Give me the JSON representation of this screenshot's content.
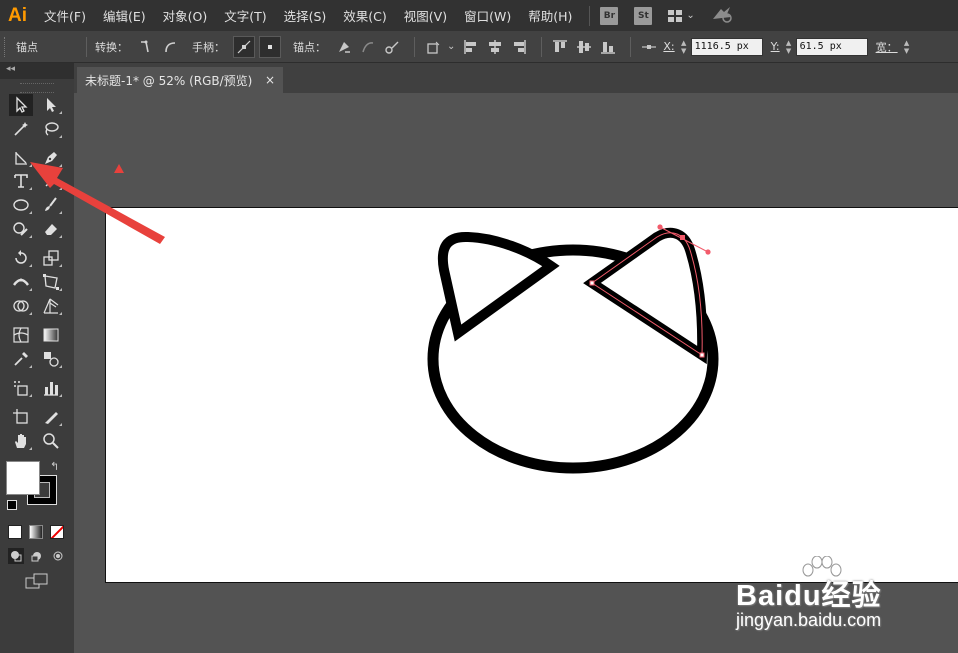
{
  "app": {
    "logo": "Ai",
    "logo_color": "#ff9a00"
  },
  "menu": {
    "items": [
      "文件(F)",
      "编辑(E)",
      "对象(O)",
      "文字(T)",
      "选择(S)",
      "效果(C)",
      "视图(V)",
      "窗口(W)",
      "帮助(H)"
    ],
    "bridge_label": "Br",
    "stock_label": "St"
  },
  "control_bar": {
    "title": "锚点",
    "convert_label": "转换：",
    "handles_label": "手柄：",
    "anchors_label": "锚点：",
    "x_label": "X:",
    "x_value": "1116.5 px",
    "y_label": "Y:",
    "y_value": "61.5 px",
    "width_label": "宽："
  },
  "document": {
    "tab_title": "未标题-1* @ 52% (RGB/预览)",
    "close_glyph": "×"
  },
  "toolbox": {
    "collapse_glyph": "◂◂",
    "tools": [
      "selection-tool",
      "direct-selection-tool",
      "magic-wand-tool",
      "lasso-tool",
      "line-segment-tool",
      "pen-tool",
      "type-tool",
      "line-tool",
      "ellipse-tool",
      "paintbrush-tool",
      "shaper-tool",
      "eraser-tool",
      "rotate-tool",
      "scale-tool",
      "width-tool",
      "free-transform-tool",
      "shape-builder-tool",
      "perspective-grid-tool",
      "mesh-tool",
      "gradient-tool",
      "eyedropper-tool",
      "blend-tool",
      "symbol-sprayer-tool",
      "column-graph-tool",
      "artboard-tool",
      "slice-tool",
      "hand-tool",
      "zoom-tool"
    ],
    "fill_color": "#ffffff",
    "stroke_color": "#000000"
  },
  "annotation": {
    "arrow_color": "#e8413c"
  },
  "watermark": {
    "brand": "Baidu经验",
    "sub": "jingyan.baidu.com"
  }
}
